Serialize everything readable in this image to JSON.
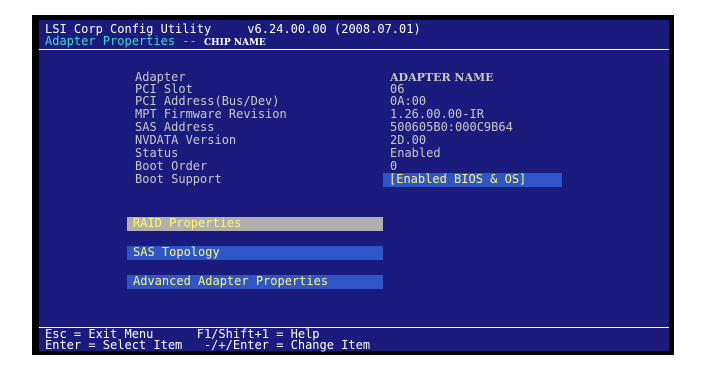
{
  "header": {
    "app_title": "LSI Corp Config Utility",
    "version": "v6.24.00.00 (2008.07.01)",
    "screen_title": "Adapter Properties -- ",
    "chip_name": "CHIP NAME"
  },
  "properties": [
    {
      "label": "Adapter",
      "value": "ADAPTER NAME"
    },
    {
      "label": "PCI Slot",
      "value": "06"
    },
    {
      "label": "PCI Address(Bus/Dev)",
      "value": "0A:00"
    },
    {
      "label": "MPT Firmware Revision",
      "value": "1.26.00.00-IR"
    },
    {
      "label": "SAS Address",
      "value": "500605B0:000C9B64"
    },
    {
      "label": "NVDATA Version",
      "value": "2D.00"
    },
    {
      "label": "Status",
      "value": "Enabled"
    },
    {
      "label": "Boot Order",
      "value": "0"
    },
    {
      "label": "Boot Support",
      "value": "[Enabled BIOS & OS]"
    }
  ],
  "menu": {
    "raid_properties": "RAID Properties",
    "sas_topology": "SAS Topology",
    "advanced_adapter_properties": "Advanced Adapter Properties"
  },
  "footer": {
    "line1": "Esc = Exit Menu      F1/Shift+1 = Help",
    "line2": "Enter = Select Item   -/+/Enter = Change Item"
  },
  "colors": {
    "background": "#1b1b7e",
    "highlight": "#2f56c9",
    "selected": "#b0b0b0",
    "title_cyan": "#3fd9d4",
    "menu_text": "#fff86b"
  }
}
